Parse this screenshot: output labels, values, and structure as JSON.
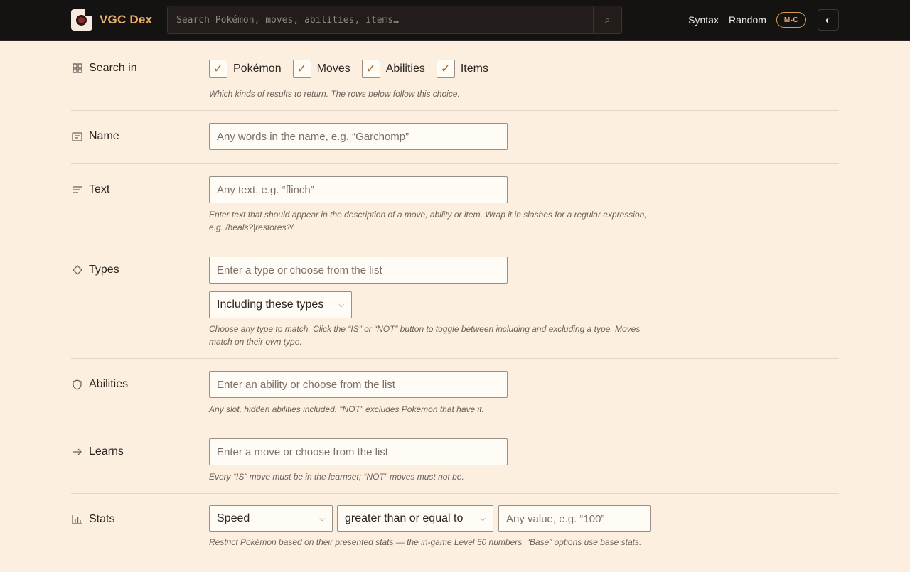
{
  "header": {
    "brand": "VGC Dex",
    "search_placeholder": "Search Pokémon, moves, abilities, items…",
    "nav": [
      "Syntax",
      "Random"
    ],
    "badge": "M-C"
  },
  "rows": {
    "search_in": {
      "label": "Search in",
      "options": [
        {
          "label": "Pokémon",
          "checked": true
        },
        {
          "label": "Moves",
          "checked": true
        },
        {
          "label": "Abilities",
          "checked": true
        },
        {
          "label": "Items",
          "checked": true
        }
      ],
      "help": "Which kinds of results to return. The rows below follow this choice."
    },
    "name": {
      "label": "Name",
      "placeholder": "Any words in the name, e.g. “Garchomp”"
    },
    "text": {
      "label": "Text",
      "placeholder": "Any text, e.g. “flinch”",
      "help": "Enter text that should appear in the description of a move, ability or item. Wrap it in slashes for a regular expression, e.g. /heals?|restores?/."
    },
    "types": {
      "label": "Types",
      "placeholder": "Enter a type or choose from the list",
      "mode": "Including these types",
      "help": "Choose any type to match. Click the “IS” or “NOT” button to toggle between including and excluding a type. Moves match on their own type."
    },
    "abilities": {
      "label": "Abilities",
      "placeholder": "Enter an ability or choose from the list",
      "help": "Any slot, hidden abilities included. “NOT” excludes Pokémon that have it."
    },
    "learns": {
      "label": "Learns",
      "placeholder": "Enter a move or choose from the list",
      "help": "Every “IS” move must be in the learnset; “NOT” moves must not be."
    },
    "stats": {
      "label": "Stats",
      "stat": "Speed",
      "comparator": "greater than or equal to",
      "value_placeholder": "Any value, e.g. “100”",
      "help": "Restrict Pokémon based on their presented stats — the in-game Level 50 numbers. “Base” options use base stats."
    }
  },
  "colors": {
    "background": "#fcefe0",
    "header": "#151212",
    "accent": "#e8b06c"
  }
}
